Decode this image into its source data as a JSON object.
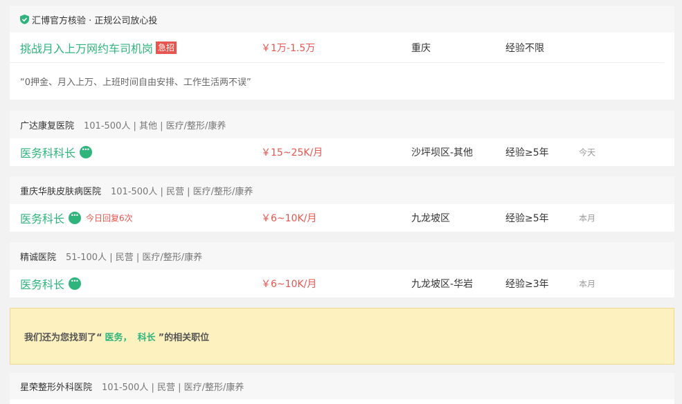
{
  "featured": {
    "verify_text": "汇博官方核验 · 正规公司放心投",
    "job_title": "挑战月入上万网约车司机岗",
    "urgent_label": "急招",
    "salary": "￥1万-1.5万",
    "location": "重庆",
    "experience": "经验不限",
    "quote": "“0押金、月入上万、上班时间自由安排、工作生活两不误”"
  },
  "jobs": [
    {
      "company": "广达康复医院",
      "meta": "101-500人 | 其他 | 医疗/整形/康养",
      "title": "医务科科长",
      "reply": "",
      "salary": "￥15~25K/月",
      "location": "沙坪坝区-其他",
      "experience": "经验≥5年",
      "time": "今天"
    },
    {
      "company": "重庆华肤皮肤病医院",
      "meta": "101-500人 | 民营 | 医疗/整形/康养",
      "title": "医务科长",
      "reply": "今日回复6次",
      "salary": "￥6~10K/月",
      "location": "九龙坡区",
      "experience": "经验≥5年",
      "time": "本月"
    },
    {
      "company": "精诚医院",
      "meta": "51-100人 | 民营 | 医疗/整形/康养",
      "title": "医务科长",
      "reply": "",
      "salary": "￥6~10K/月",
      "location": "九龙坡区-华岩",
      "experience": "经验≥3年",
      "time": "本月"
    },
    {
      "company": "星荣整形外科医院",
      "meta": "101-500人 | 民营 | 医疗/整形/康养"
    }
  ],
  "notice": {
    "prefix": "我们还为您找到了“",
    "keyword1": "医务，",
    "keyword2": "科长",
    "suffix": "”的相关职位"
  },
  "colors": {
    "accent": "#2fb47c",
    "salary": "#e8554e",
    "notice_bg": "#fdf1c0"
  }
}
